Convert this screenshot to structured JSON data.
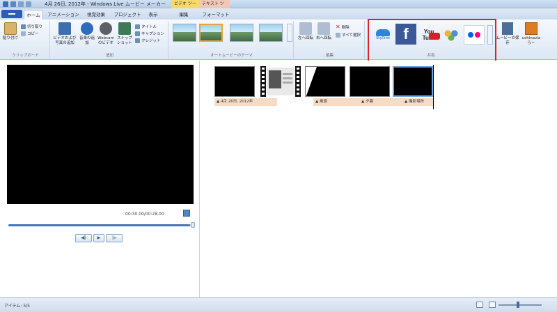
{
  "title": {
    "text": "4月 26日, 2012年 - Windows Live ムービー メーカー",
    "context_video": "ビデオ ツール",
    "context_text": "テキスト ツール"
  },
  "tabs": [
    "ホーム",
    "アニメーション",
    "視覚効果",
    "プロジェクト",
    "表示",
    "編集",
    "フォーマット"
  ],
  "ribbon": {
    "clipboard": {
      "label": "クリップボード",
      "paste": "貼り付け",
      "cut": "切り取り",
      "copy": "コピー"
    },
    "add": {
      "label": "追加",
      "add_videos": "ビデオおよび写真の追加",
      "add_music": "音楽の追加",
      "webcam": "Webcam のビデオ",
      "snapshot": "スナップショット",
      "title": "タイトル",
      "caption": "キャプション",
      "credits": "クレジット"
    },
    "autothemes": {
      "label": "オートムービーのテーマ"
    },
    "editing": {
      "label": "編集",
      "rotate_left": "左へ回転",
      "rotate_right": "右へ回転",
      "delete": "削除",
      "select_all": "すべて選択"
    },
    "share": {
      "label": "共有",
      "skydrive": "SkyDrive",
      "facebook": "f",
      "youtube": "You Tube",
      "flickr": "flickr",
      "save_movie": "ムービーの保存",
      "user_name": "uchinavia らー"
    }
  },
  "preview": {
    "timecode": "00:30.00/00:28.00",
    "seek_fraction": 0.98,
    "prev_frame": "◀‖",
    "play": "▶",
    "next_frame": "‖▶"
  },
  "storyboard": {
    "captions": [
      "4月 26日, 2012年",
      "風景",
      "夕暮",
      "撮影場所"
    ]
  },
  "status": {
    "items": "アイテム: 5/5"
  }
}
